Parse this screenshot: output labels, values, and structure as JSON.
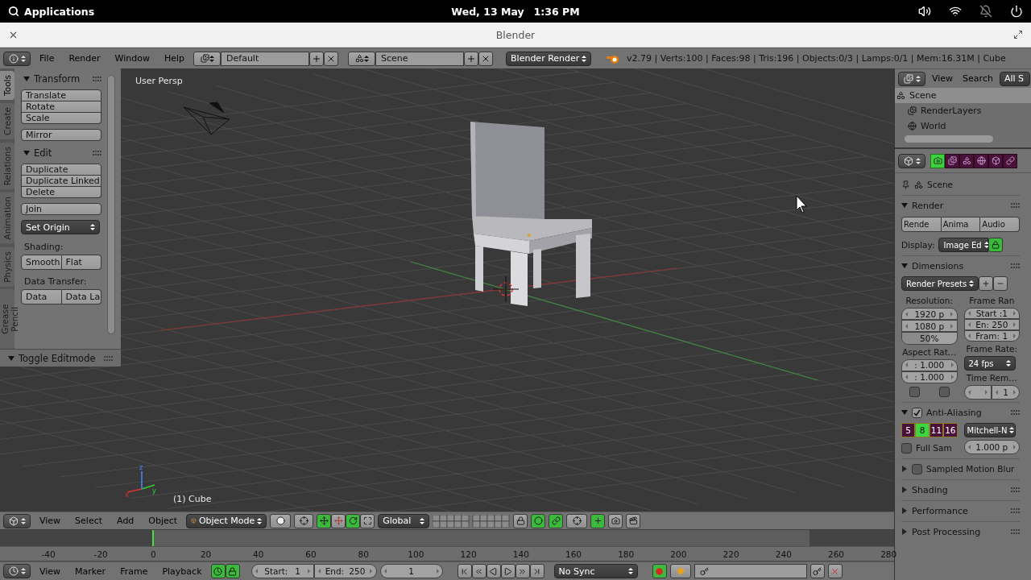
{
  "system_bar": {
    "launcher": "Applications",
    "date": "Wed, 13 May",
    "time": "1:36 PM"
  },
  "window": {
    "title": "Blender"
  },
  "info_header": {
    "menus": [
      "File",
      "Render",
      "Window",
      "Help"
    ],
    "screen_layout": "Default",
    "scene": "Scene",
    "render_engine": "Blender Render",
    "stats": "v2.79 | Verts:100 | Faces:98 | Tris:196 | Objects:0/3 | Lamps:0/1 | Mem:16.31M | Cube"
  },
  "tool_shelf": {
    "tabs": [
      {
        "label": "Tools",
        "selected": true
      },
      {
        "label": "Create",
        "selected": false
      },
      {
        "label": "Relations",
        "selected": false
      },
      {
        "label": "Animation",
        "selected": false
      },
      {
        "label": "Physics",
        "selected": false
      },
      {
        "label": "Grease Pencil",
        "selected": false
      }
    ],
    "panels": [
      {
        "title": "Transform",
        "expanded": true,
        "items": [
          {
            "kind": "stack",
            "buttons": [
              "Translate",
              "Rotate",
              "Scale"
            ]
          },
          {
            "kind": "stack",
            "buttons": [
              "Mirror"
            ]
          }
        ]
      },
      {
        "title": "Edit",
        "expanded": true,
        "items": [
          {
            "kind": "stack",
            "buttons": [
              "Duplicate",
              "Duplicate Linked",
              "Delete"
            ]
          },
          {
            "kind": "stack",
            "buttons": [
              "Join"
            ]
          },
          {
            "kind": "dropdown",
            "value": "Set Origin"
          },
          {
            "kind": "label",
            "text": "Shading:"
          },
          {
            "kind": "row",
            "buttons": [
              "Smooth",
              "Flat"
            ]
          },
          {
            "kind": "label",
            "text": "Data Transfer:"
          },
          {
            "kind": "row",
            "buttons": [
              "Data",
              "Data La"
            ]
          }
        ]
      }
    ],
    "operator_panel": {
      "title": "Toggle Editmode",
      "expanded": true
    }
  },
  "viewport": {
    "view_name": "User Persp",
    "active_object": "(1) Cube",
    "axes": [
      "x",
      "y",
      "z"
    ]
  },
  "view_header": {
    "menus": [
      "View",
      "Select",
      "Add",
      "Object"
    ],
    "mode": "Object Mode",
    "orientation": "Global"
  },
  "timeline": {
    "playhead": {
      "level": 0.171
    },
    "ticks": [
      "-40",
      "-20",
      "0",
      "20",
      "40",
      "60",
      "80",
      "100",
      "120",
      "140",
      "160",
      "180",
      "200",
      "220",
      "240",
      "260",
      "280"
    ],
    "header": {
      "menus": [
        "View",
        "Marker",
        "Frame",
        "Playback"
      ],
      "start_label": "Start:",
      "start": "1",
      "end_label": "End:",
      "end": "250",
      "current": "1",
      "sync": "No Sync"
    }
  },
  "outliner": {
    "menus": [
      "View",
      "Search"
    ],
    "filter": "All S",
    "items": [
      {
        "label": "Scene",
        "selected": true,
        "children": [
          {
            "label": "RenderLayers",
            "selected": false
          },
          {
            "label": "World",
            "selected": false
          }
        ]
      }
    ]
  },
  "properties": {
    "tabs": [
      {
        "kind": "render",
        "selected": true
      },
      {
        "kind": "layers",
        "selected": false
      },
      {
        "kind": "scene",
        "selected": false
      },
      {
        "kind": "world",
        "selected": false
      },
      {
        "kind": "object",
        "selected": false
      },
      {
        "kind": "constraints",
        "selected": false
      }
    ],
    "context": "Scene",
    "render": {
      "title": "Render",
      "expanded": true,
      "buttons": [
        "Rende",
        "Anima",
        "Audio"
      ],
      "display_label": "Display:",
      "display": "Image Ed"
    },
    "dimensions": {
      "title": "Dimensions",
      "expanded": true,
      "presets": "Render Presets",
      "resolution_label": "Resolution:",
      "resolution_x": "1920 p",
      "resolution_y": "1080 p",
      "percentage": {
        "text": "50%",
        "level": 0.5
      },
      "frame_range_label": "Frame Ran",
      "frame_start": "Start :1",
      "frame_end": "En: 250",
      "frame_step": "Fram: 1",
      "aspect_label": "Aspect Rat…",
      "aspect_x": ": 1.000",
      "aspect_y": ": 1.000",
      "border_checked": false,
      "crop_checked": false,
      "frame_rate_label": "Frame Rate:",
      "frame_rate": "24 fps",
      "time_remap_label": "Time Rem…",
      "time_remap_new": "1"
    },
    "anti_aliasing": {
      "title": "Anti-Aliasing",
      "expanded": true,
      "checked": true,
      "samples": [
        {
          "label": "5",
          "selected": false
        },
        {
          "label": "8",
          "selected": true
        },
        {
          "label": "11",
          "selected": false
        },
        {
          "label": "16",
          "selected": false
        }
      ],
      "filter": "Mitchell-N",
      "full_sample_label": "Full Sam",
      "full_sample": false,
      "filter_size": "1.000 p"
    },
    "motion_blur": {
      "title": "Sampled Motion Blur",
      "expanded": false,
      "checked": false
    },
    "more_panels": [
      {
        "title": "Shading",
        "expanded": false
      },
      {
        "title": "Performance",
        "expanded": false
      },
      {
        "title": "Post Processing",
        "expanded": false
      }
    ]
  }
}
